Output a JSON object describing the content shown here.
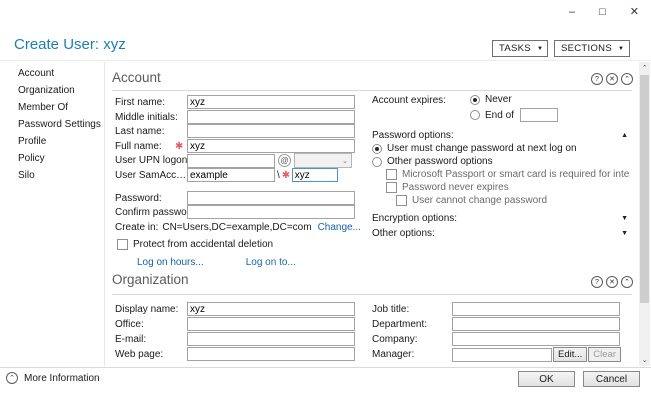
{
  "window": {
    "title": "Create User: xyz",
    "minimize_glyph": "–",
    "maximize_glyph": "□",
    "close_glyph": "✕"
  },
  "header": {
    "tasks_label": "TASKS",
    "sections_label": "SECTIONS",
    "dropdown_glyph": "▼"
  },
  "sidebar": {
    "items": [
      {
        "label": "Account"
      },
      {
        "label": "Organization"
      },
      {
        "label": "Member Of"
      },
      {
        "label": "Password Settings"
      },
      {
        "label": "Profile"
      },
      {
        "label": "Policy"
      },
      {
        "label": "Silo"
      }
    ]
  },
  "section_icons": {
    "help_glyph": "?",
    "close_glyph": "✕",
    "collapse_glyph": "⌃"
  },
  "account": {
    "title": "Account",
    "first_name_label": "First name:",
    "first_name_value": "xyz",
    "middle_initials_label": "Middle initials:",
    "middle_initials_value": "",
    "last_name_label": "Last name:",
    "last_name_value": "",
    "full_name_label": "Full name:",
    "full_name_value": "xyz",
    "required_glyph": "✱",
    "upn_label": "User UPN logon:",
    "upn_value": "",
    "upn_at_glyph": "@",
    "upn_dropdown_glyph": "⌄",
    "sam_label": "User SamAccountNam...",
    "sam_domain_value": "example",
    "sam_separator": "\\",
    "sam_value": "xyz",
    "password_label": "Password:",
    "password_value": "",
    "confirm_label": "Confirm password:",
    "confirm_value": "",
    "create_in_label": "Create in:",
    "create_in_value": "CN=Users,DC=example,DC=com",
    "change_link": "Change...",
    "protect_label": "Protect from accidental deletion",
    "log_on_hours_link": "Log on hours...",
    "log_on_to_link": "Log on to...",
    "account_expires_label": "Account expires:",
    "never_label": "Never",
    "end_of_label": "End of",
    "end_of_value": "",
    "password_options_label": "Password options:",
    "collapse_glyph": "▲",
    "expand_glyph": "▼",
    "must_change_label": "User must change password at next log on",
    "other_password_radio_label": "Other password options",
    "smart_card_label": "Microsoft Passport or smart card is required for interactiv...",
    "never_expires_label": "Password never expires",
    "cannot_change_label": "User cannot change password",
    "encryption_options_label": "Encryption options:",
    "other_options_label": "Other options:"
  },
  "organization": {
    "title": "Organization",
    "display_name_label": "Display name:",
    "display_name_value": "xyz",
    "office_label": "Office:",
    "office_value": "",
    "email_label": "E-mail:",
    "email_value": "",
    "web_page_label": "Web page:",
    "web_page_value": "",
    "job_title_label": "Job title:",
    "job_title_value": "",
    "department_label": "Department:",
    "department_value": "",
    "company_label": "Company:",
    "company_value": "",
    "manager_label": "Manager:",
    "manager_value": "",
    "edit_button_label": "Edit...",
    "clear_button_label": "Clear"
  },
  "footer": {
    "more_information_label": "More Information",
    "expander_glyph": "⌃",
    "ok_label": "OK",
    "cancel_label": "Cancel"
  },
  "scrollbar": {
    "up_glyph": "⌃",
    "down_glyph": "⌄"
  },
  "colors": {
    "title_accent": "#1b7fb5",
    "link": "#1464a8",
    "required": "#e8596a"
  }
}
